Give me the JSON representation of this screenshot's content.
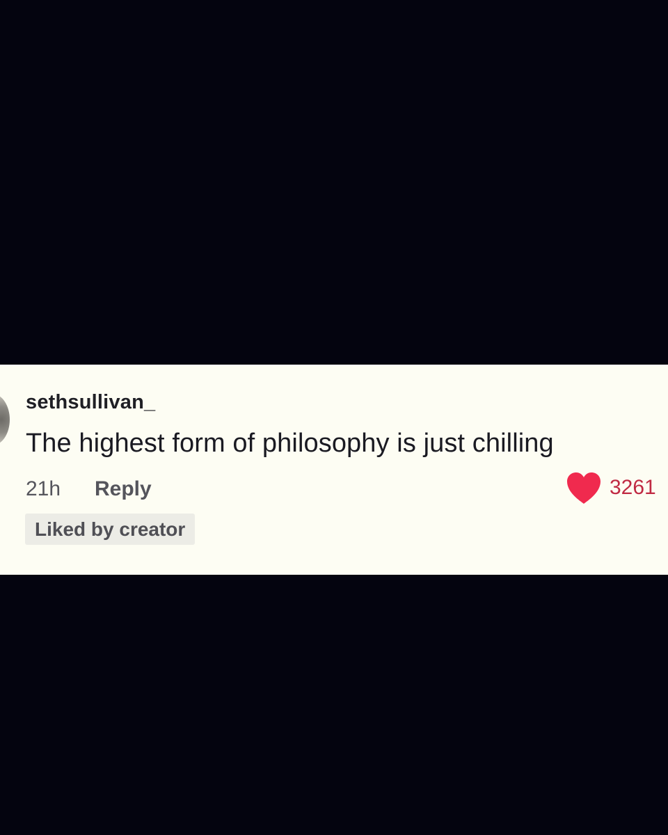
{
  "comment": {
    "username": "sethsullivan_",
    "text": "The highest form of philosophy is just chilling",
    "time": "21h",
    "reply_label": "Reply",
    "like_count": "3261",
    "creator_badge": "Liked by creator"
  },
  "colors": {
    "background": "#04040f",
    "card": "#fdfdf3",
    "heart": "#f02a4e",
    "like_count": "#c02a43"
  },
  "icons": {
    "like": "heart-icon"
  }
}
